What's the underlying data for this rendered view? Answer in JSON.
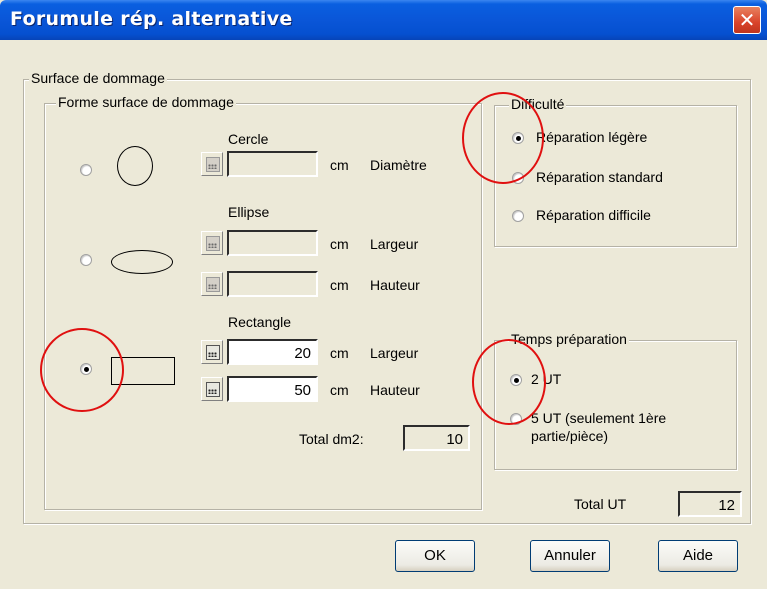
{
  "window": {
    "title": "Forumule rép. alternative",
    "close_glyph": "✕"
  },
  "surface": {
    "legend": "Surface de dommage",
    "forme": {
      "legend": "Forme surface de dommage",
      "cercle": {
        "label": "Cercle",
        "unit": "cm",
        "dim_label": "Diamètre",
        "value": ""
      },
      "ellipse": {
        "label": "Ellipse",
        "unit1": "cm",
        "dim1_label": "Largeur",
        "value1": "",
        "unit2": "cm",
        "dim2_label": "Hauteur",
        "value2": ""
      },
      "rectangle": {
        "label": "Rectangle",
        "unit1": "cm",
        "dim1_label": "Largeur",
        "value1": "20",
        "unit2": "cm",
        "dim2_label": "Hauteur",
        "value2": "50"
      },
      "selected": "rectangle",
      "total_label": "Total dm2:",
      "total_value": "10"
    },
    "difficulte": {
      "legend": "Difficulté",
      "options": [
        "Réparation légère",
        "Réparation standard",
        "Réparation difficile"
      ],
      "selected": 0
    },
    "temps": {
      "legend": "Temps préparation",
      "options": [
        "2 UT",
        "5 UT (seulement 1ère",
        "partie/pièce)"
      ],
      "selected": 0
    }
  },
  "total_ut": {
    "label": "Total UT",
    "value": "12"
  },
  "buttons": {
    "ok": "OK",
    "annuler": "Annuler",
    "aide": "Aide"
  },
  "icons": {
    "calculator": "calculator-icon",
    "close": "close-icon"
  },
  "colors": {
    "titlebar": "#0a56d8",
    "dialog_bg": "#ece9d8",
    "annotation": "#e01010"
  }
}
